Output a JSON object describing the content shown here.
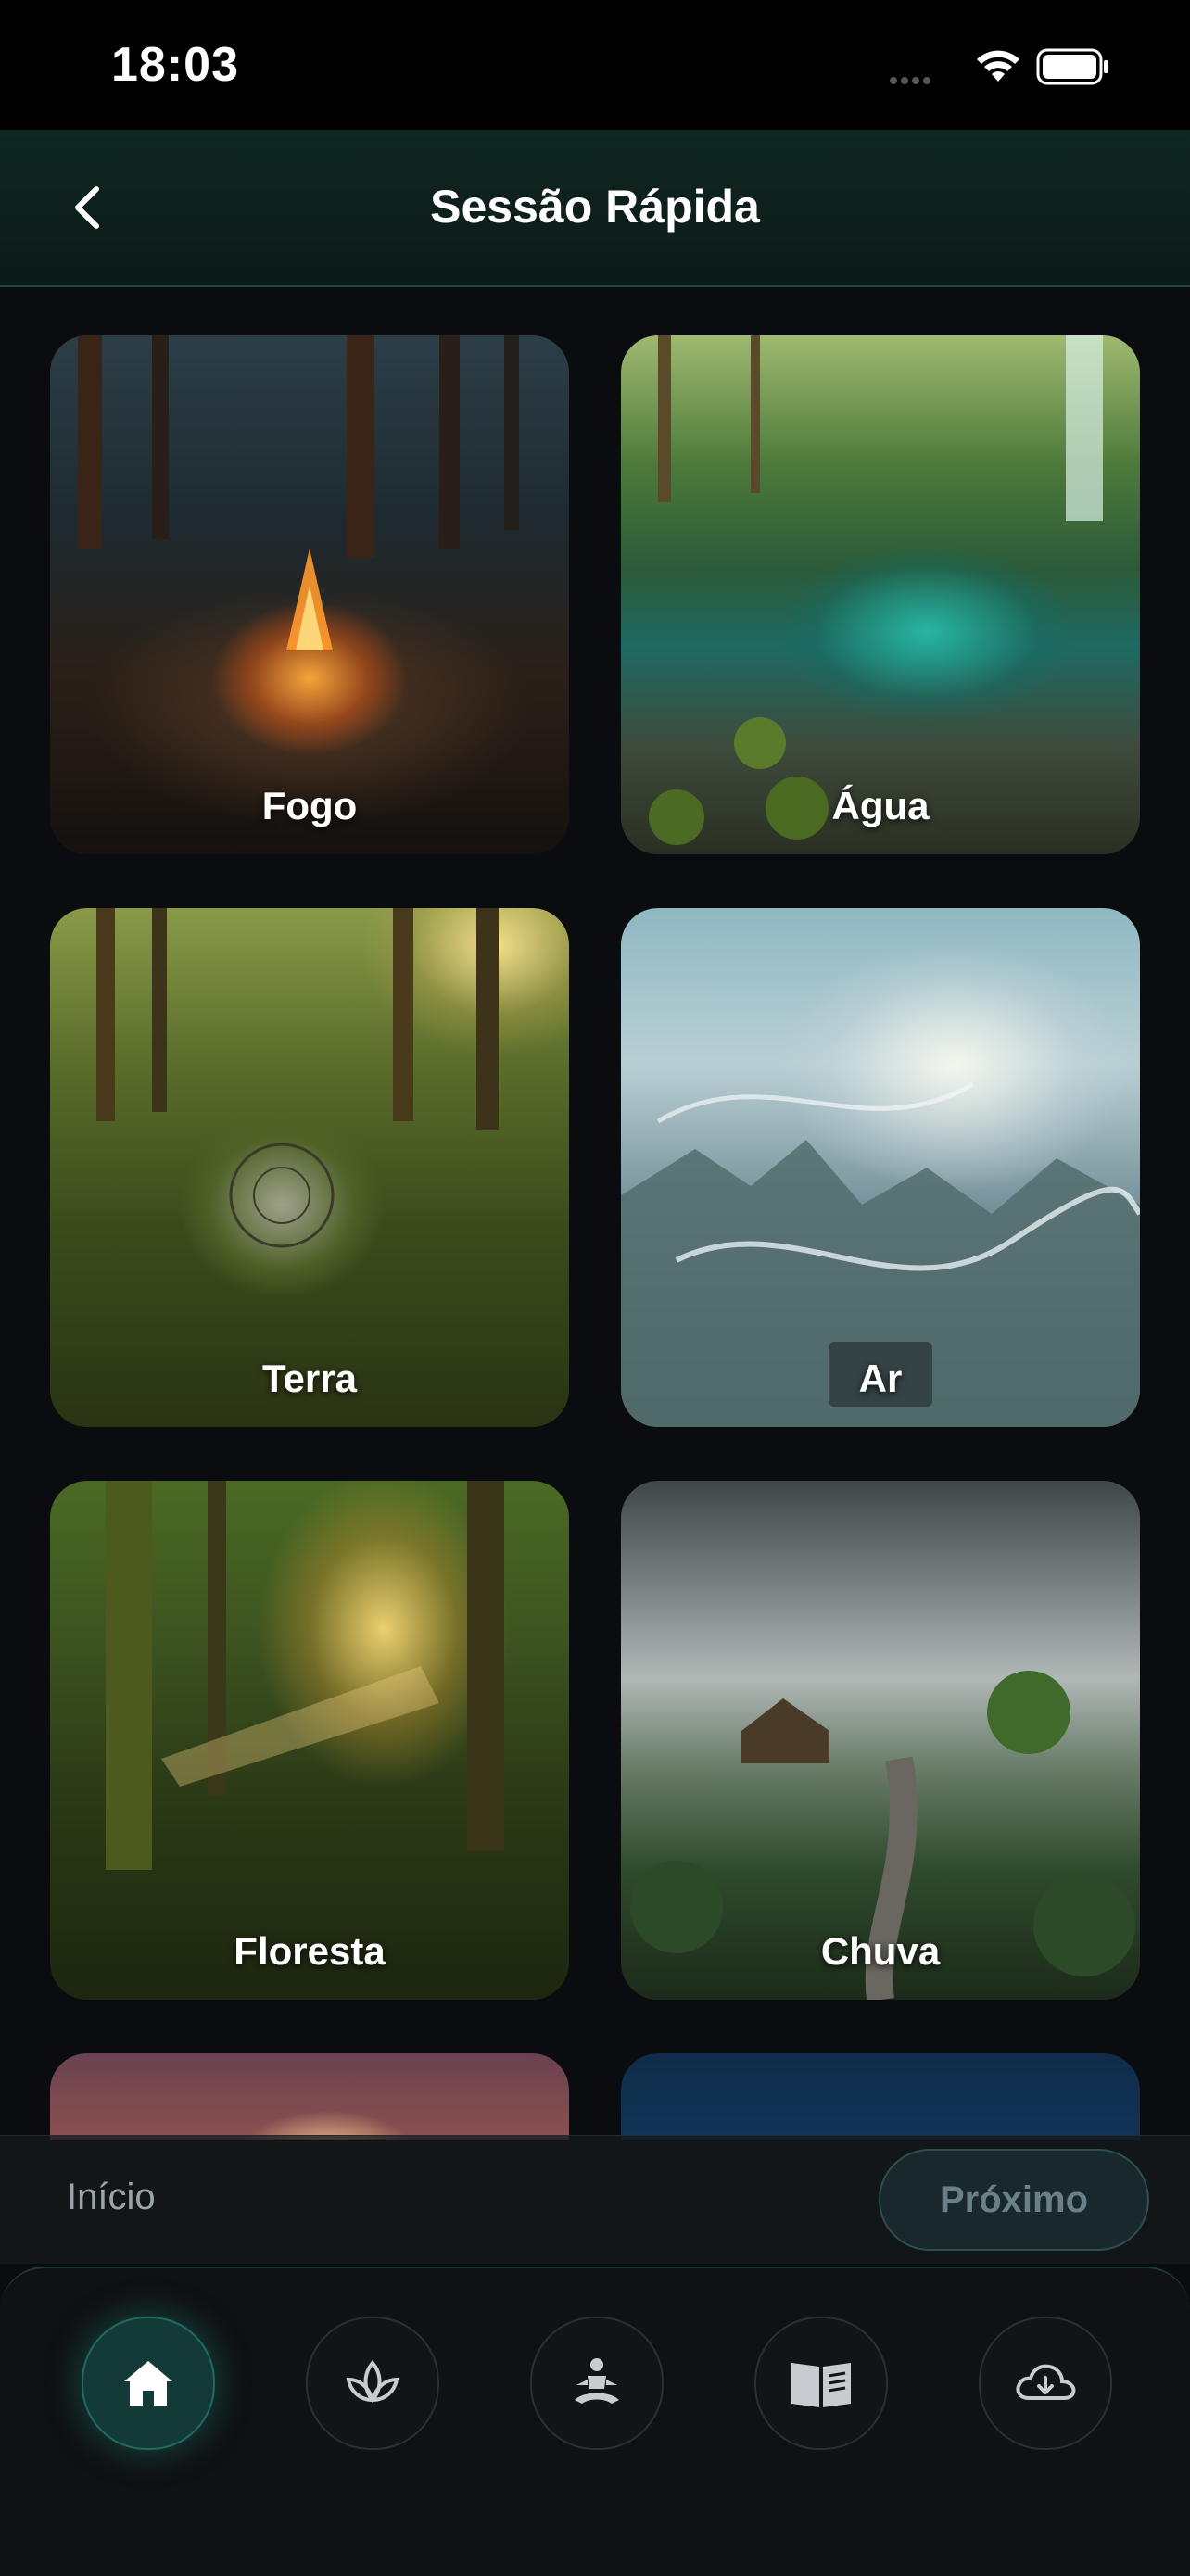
{
  "status_bar": {
    "time": "18:03"
  },
  "header": {
    "title": "Sessão Rápida"
  },
  "cards": [
    {
      "label": "Fogo"
    },
    {
      "label": "Água"
    },
    {
      "label": "Terra"
    },
    {
      "label": "Ar"
    },
    {
      "label": "Floresta"
    },
    {
      "label": "Chuva"
    },
    {
      "label": ""
    },
    {
      "label": ""
    }
  ],
  "wizard": {
    "start_label": "Início",
    "next_label": "Próximo"
  },
  "bottom_nav": {
    "items": [
      {
        "icon": "home-icon",
        "active": true
      },
      {
        "icon": "lotus-icon",
        "active": false
      },
      {
        "icon": "meditation-icon",
        "active": false
      },
      {
        "icon": "book-icon",
        "active": false
      },
      {
        "icon": "cloud-download-icon",
        "active": false
      }
    ]
  },
  "colors": {
    "accent": "#1f6b62",
    "header_bg": "#0f2622",
    "background": "#0b0c0f"
  }
}
